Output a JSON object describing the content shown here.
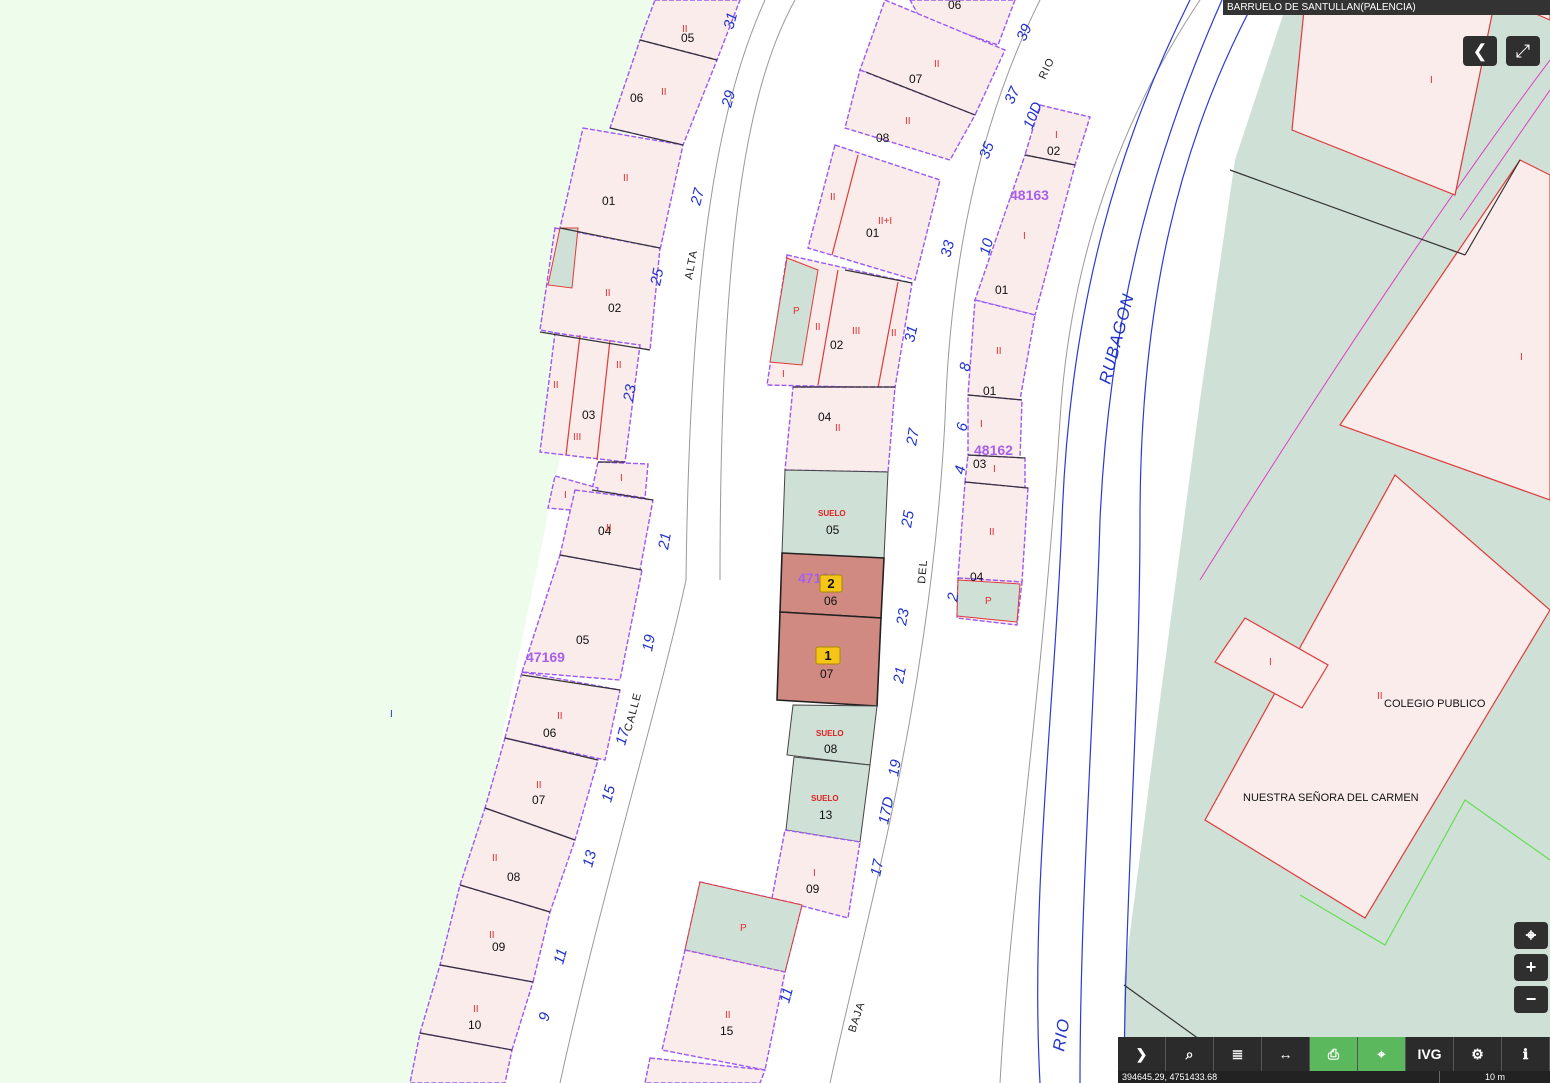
{
  "location_title": "BARRUELO DE SANTULLAN(PALENCIA)",
  "controls": {
    "collapse_icon": "chevron-left-icon",
    "fullscreen_icon": "expand-icon",
    "locate_icon": "crosshair-icon",
    "zoom_in": "+",
    "zoom_out": "−"
  },
  "toolbar": [
    {
      "name": "expand-panel",
      "icon": "chevron-right-icon",
      "glyph": "❯"
    },
    {
      "name": "search",
      "icon": "search-icon",
      "glyph": "⌕"
    },
    {
      "name": "layers",
      "icon": "layers-icon",
      "glyph": "≣"
    },
    {
      "name": "measure",
      "icon": "measure-icon",
      "glyph": "↔"
    },
    {
      "name": "print",
      "icon": "print-icon",
      "glyph": "⎙",
      "active": true
    },
    {
      "name": "parcel-info",
      "icon": "parcel-icon",
      "glyph": "⌖",
      "active": true
    },
    {
      "name": "ivg",
      "icon": "ivg-label",
      "glyph": "IVG"
    },
    {
      "name": "tools",
      "icon": "tools-icon",
      "glyph": "⚙"
    },
    {
      "name": "info",
      "icon": "info-icon",
      "glyph": "ℹ"
    }
  ],
  "status": {
    "coordinates": "394645.29, 4751433.68",
    "scale": "10 m"
  },
  "map": {
    "blocks": [
      "47169",
      "48163",
      "48162",
      "47166"
    ],
    "streets": {
      "alta": "ALTA",
      "calle": "CALLE",
      "del": "DEL",
      "baja": "BAJA",
      "rio_top": "RIO",
      "rubagon": "RUBAGON",
      "rio_bottom": "RIO"
    },
    "school_line1": "COLEGIO PUBLICO",
    "school_line2": "NUESTRA SEÑORA DEL CARMEN",
    "suelo": "SUELO",
    "markers": [
      "1",
      "2"
    ],
    "house_numbers_left": [
      "31",
      "29",
      "27",
      "25",
      "23",
      "21",
      "19",
      "17",
      "15",
      "13",
      "11",
      "9"
    ],
    "house_numbers_center": [
      "39",
      "37",
      "35",
      "33",
      "31",
      "27",
      "25",
      "23",
      "21",
      "19",
      "17D",
      "17",
      "11"
    ],
    "house_numbers_right": [
      "10D",
      "10",
      "8",
      "6",
      "4",
      "2"
    ],
    "parcels_left": [
      "05",
      "06",
      "01",
      "02",
      "03",
      "04",
      "05",
      "06",
      "07",
      "08",
      "09",
      "10"
    ],
    "parcels_center": [
      "06",
      "07",
      "08",
      "01",
      "02",
      "04",
      "05",
      "06",
      "07",
      "08",
      "13",
      "09",
      "15"
    ],
    "parcels_right": [
      "02",
      "01",
      "01",
      "03",
      "04"
    ],
    "floors": {
      "i": "I",
      "ii": "II",
      "iii": "III",
      "iiii": "II+I",
      "p": "P"
    }
  }
}
